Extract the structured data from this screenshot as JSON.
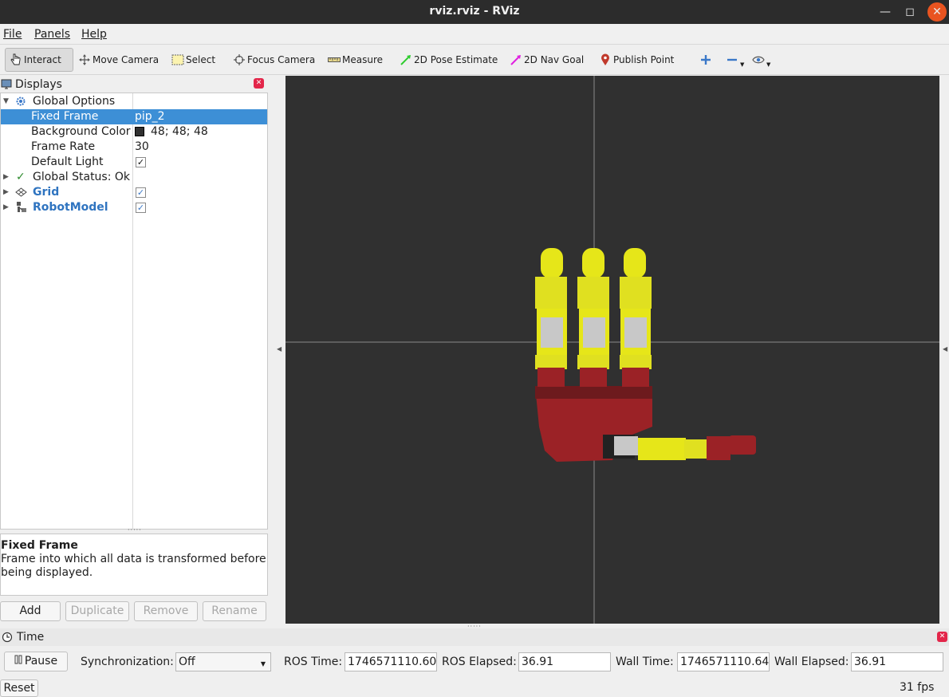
{
  "window": {
    "title": "rviz.rviz - RViz"
  },
  "menu": {
    "file": "File",
    "panels": "Panels",
    "help": "Help"
  },
  "toolbar": {
    "interact": "Interact",
    "move_camera": "Move Camera",
    "select": "Select",
    "focus_camera": "Focus Camera",
    "measure": "Measure",
    "pose_estimate": "2D Pose Estimate",
    "nav_goal": "2D Nav Goal",
    "publish_point": "Publish Point"
  },
  "displays": {
    "title": "Displays",
    "global_options": "Global Options",
    "fixed_frame_label": "Fixed Frame",
    "fixed_frame_value": "pip_2",
    "background_color_label": "Background Color",
    "background_color_value": "48; 48; 48",
    "frame_rate_label": "Frame Rate",
    "frame_rate_value": "30",
    "default_light_label": "Default Light",
    "global_status": "Global Status: Ok",
    "grid": "Grid",
    "robot_model": "RobotModel",
    "default_light_checked": true,
    "grid_checked": true,
    "robot_model_checked": true
  },
  "description": {
    "title": "Fixed Frame",
    "text": "Frame into which all data is transformed before being displayed."
  },
  "panel_buttons": {
    "add": "Add",
    "duplicate": "Duplicate",
    "remove": "Remove",
    "rename": "Rename"
  },
  "time": {
    "title": "Time",
    "pause": "Pause",
    "sync_label": "Synchronization:",
    "sync_value": "Off",
    "ros_time_label": "ROS Time:",
    "ros_time": "1746571110.60",
    "ros_elapsed_label": "ROS Elapsed:",
    "ros_elapsed": "36.91",
    "wall_time_label": "Wall Time:",
    "wall_time": "1746571110.64",
    "wall_elapsed_label": "Wall Elapsed:",
    "wall_elapsed": "36.91"
  },
  "status": {
    "reset": "Reset",
    "fps": "31 fps"
  },
  "colors": {
    "background": "#303030",
    "selection": "#3d8fd6",
    "finger_yellow": "#e6e619",
    "palm_red": "#9b2226",
    "joint_gray": "#c8c8c8"
  }
}
